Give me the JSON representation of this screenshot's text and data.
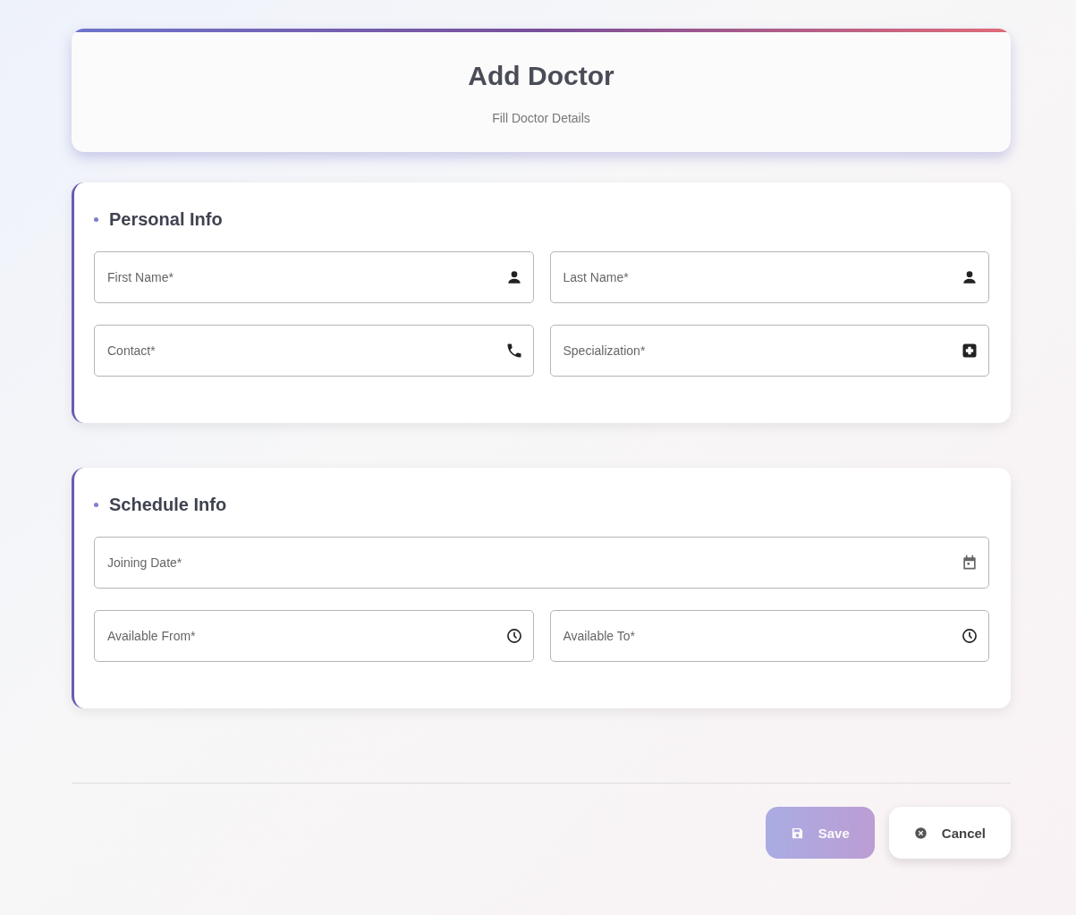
{
  "header": {
    "title": "Add Doctor",
    "subtitle": "Fill Doctor Details"
  },
  "sections": [
    {
      "title": "Personal Info",
      "rows": [
        [
          {
            "placeholder": "First Name*",
            "kind": "person"
          },
          {
            "placeholder": "Last Name*",
            "kind": "person"
          }
        ],
        [
          {
            "placeholder": "Contact*",
            "kind": "phone"
          },
          {
            "placeholder": "Specialization*",
            "kind": "medical"
          }
        ]
      ]
    },
    {
      "title": "Schedule Info",
      "rows": [
        [
          {
            "placeholder": "Joining Date*",
            "kind": "calendar"
          }
        ],
        [
          {
            "placeholder": "Available From*",
            "kind": "clock"
          },
          {
            "placeholder": "Available To*",
            "kind": "clock"
          }
        ]
      ]
    }
  ],
  "buttons": [
    {
      "label": "Save",
      "kind": "primary",
      "disabled": true
    },
    {
      "label": "Cancel",
      "kind": "secondary",
      "disabled": false
    }
  ]
}
